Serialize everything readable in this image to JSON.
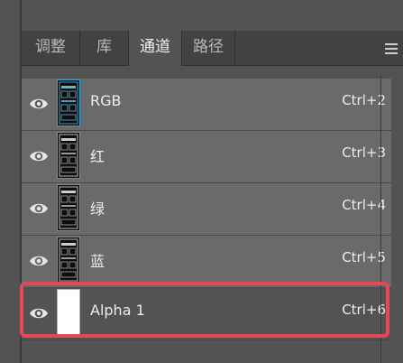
{
  "tabs": [
    {
      "label": "调整"
    },
    {
      "label": "库"
    },
    {
      "label": "通道"
    },
    {
      "label": "路径"
    }
  ],
  "channels": [
    {
      "label": "RGB",
      "shortcut": "Ctrl+2"
    },
    {
      "label": "红",
      "shortcut": "Ctrl+3"
    },
    {
      "label": "绿",
      "shortcut": "Ctrl+4"
    },
    {
      "label": "蓝",
      "shortcut": "Ctrl+5"
    },
    {
      "label": "Alpha 1",
      "shortcut": "Ctrl+6"
    }
  ],
  "colors": {
    "highlight": "#e24a5a",
    "row": "#6a6a6a",
    "tab_bar": "#424242"
  }
}
